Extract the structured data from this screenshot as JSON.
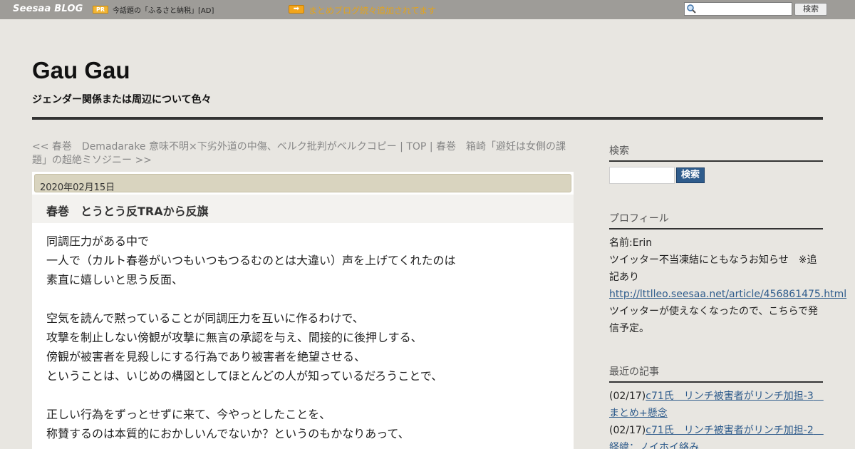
{
  "topbar": {
    "logo": "Seesaa BLOG",
    "pr_badge": "PR",
    "ad_text": "今話題の「ふるさと納税」[AD]",
    "arrow_glyph": "➡",
    "news_text": "まとめブログ続々追加されてます",
    "search_value": "",
    "search_button": "検索",
    "colors": {
      "bar": "#9e9c98",
      "news": "#e3a31b"
    }
  },
  "header": {
    "title": "Gau Gau",
    "description": "ジェンダー関係または周辺について色々"
  },
  "breadcrumb": {
    "prev_link": "<< 春巻　Demadarake 意味不明×下劣外道の中傷、ベルク批判がベルクコピー",
    "sep1": " | ",
    "top_link": "TOP",
    "sep2": " | ",
    "next_link": "春巻　箱崎「避妊は女側の課題」の超絶ミソジニー >>"
  },
  "entry": {
    "date": "2020年02月15日",
    "title": "春巻　とうとう反TRAから反旗",
    "lines": [
      "同調圧力がある中で",
      "一人で（カルト春巻がいつもいつもつるむのとは大違い）声を上げてくれたのは",
      "素直に嬉しいと思う反面、",
      "",
      "空気を読んで黙っていることが同調圧力を互いに作るわけで、",
      "攻撃を制止しない傍観が攻撃に無言の承認を与え、間接的に後押しする、",
      "傍観が被害者を見殺しにする行為であり被害者を絶望させる、",
      "ということは、いじめの構図としてほとんどの人が知っているだろうことで、",
      "",
      "正しい行為をずっとせずに来て、今やっとしたことを、",
      "称賛するのは本質的におかしいんでないか？というのもかなりあって、"
    ]
  },
  "sidebar": {
    "search": {
      "heading": "検索",
      "button": "検索",
      "value": ""
    },
    "profile": {
      "heading": "プロフィール",
      "name_line": "名前:Erin",
      "notice": "ツイッター不当凍結にともなうお知らせ　※追記あり",
      "link": "http://lttlleo.seesaa.net/article/456861475.html",
      "after_link": "ツイッターが使えなくなったので、こちらで発信予定。"
    },
    "recent": {
      "heading": "最近の記事",
      "items": [
        {
          "date": "(02/17)",
          "title": "c71氏　リンチ被害者がリンチ加担-3　まとめ+懸念"
        },
        {
          "date": "(02/17)",
          "title": "c71氏　リンチ被害者がリンチ加担-2　経緯：ノイホイ絡み"
        }
      ]
    }
  }
}
